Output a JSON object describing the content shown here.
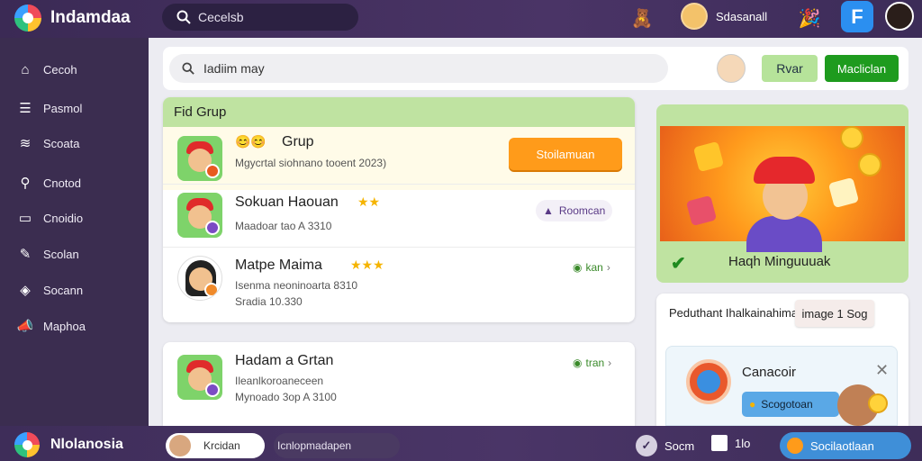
{
  "app": {
    "title": "Indamdaa",
    "search_placeholder": "Cecelsb"
  },
  "top": {
    "user_name": "Sdasanall",
    "icon_names": [
      "sticker-icon",
      "avatar-icon",
      "party-icon",
      "f-app-icon",
      "profile-icon"
    ],
    "f_badge": "F"
  },
  "sidebar": {
    "items": [
      {
        "label": "Cecoh",
        "icon": "home-icon"
      },
      {
        "label": "Pasmol",
        "icon": "grid-icon"
      },
      {
        "label": "Scoata",
        "icon": "layers-icon"
      },
      {
        "label": "Cnotod",
        "icon": "search-icon"
      },
      {
        "label": "Cnoidio",
        "icon": "calendar-icon"
      },
      {
        "label": "Scolan",
        "icon": "edit-icon"
      },
      {
        "label": "Socann",
        "icon": "stack-icon"
      },
      {
        "label": "Maphoa",
        "icon": "megaphone-icon"
      }
    ]
  },
  "main": {
    "search_placeholder": "Iadiim may",
    "btn_light": "Rvar",
    "btn_green": "Macliclan"
  },
  "group": {
    "title": "Fid Grup",
    "rows": [
      {
        "title": "Grup",
        "sub": "Mgycrtal siohnano tooent 2023)",
        "action": "Stoilamuan"
      },
      {
        "title": "Sokuan Haouan",
        "sub": "Maadoar tao A 3310",
        "action": "Roomcan"
      },
      {
        "title": "Matpe Maima",
        "sub1": "Isenma neoninoarta 8310",
        "sub2": "Sradia 10.330",
        "action": "kan"
      }
    ]
  },
  "card2": {
    "title": "Hadam a Grtan",
    "sub1": "Ileanlkoroaneceen",
    "sub2": "Mynoado 3op A 3100",
    "action": "tran"
  },
  "promo": {
    "text": "Haqh Minguuuak"
  },
  "notice": {
    "title": "Peduthant Ihalkainahimage 1 Sog",
    "chip": "image 1 Sog",
    "name": "Canacoir",
    "button": "Scogotoan"
  },
  "bottom": {
    "title": "Nlolanosia",
    "pill": "Krcidan",
    "text": "Icnlopmadapen",
    "item1": "Socm",
    "item2": "1lo",
    "cta": "Socilaotlaan"
  },
  "colors": {
    "topbar": "#4a3466",
    "accent_green": "#1e9b1e",
    "accent_orange": "#ff9b1a",
    "sidebar": "#3b2d50"
  }
}
